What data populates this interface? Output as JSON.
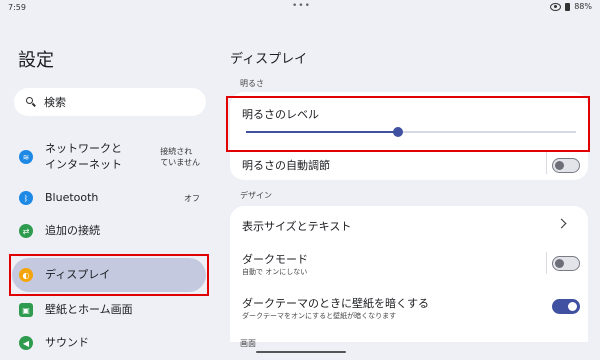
{
  "status_bar": {
    "time": "7:59",
    "battery": "88%"
  },
  "left": {
    "title": "設定",
    "search_label": "検索",
    "items": [
      {
        "label": "ネットワークと\nインターネット",
        "status": "接続され\nていません",
        "icon": "wifi-icon",
        "color": "#1e88e5"
      },
      {
        "label": "Bluetooth",
        "status": "オフ",
        "icon": "bluetooth-icon",
        "color": "#1e88e5"
      },
      {
        "label": "追加の接続",
        "status": "",
        "icon": "connected-devices-icon",
        "color": "#2e9b4e"
      },
      {
        "label": "ディスプレイ",
        "status": "",
        "icon": "brightness-icon",
        "color": "#f2a50c"
      },
      {
        "label": "壁紙とホーム画面",
        "status": "",
        "icon": "wallpaper-icon",
        "color": "#2e9b4e"
      },
      {
        "label": "サウンド",
        "status": "",
        "icon": "sound-icon",
        "color": "#2e9b4e"
      }
    ]
  },
  "right": {
    "title": "ディスプレイ",
    "brightness_section": "明るさ",
    "brightness_level_label": "明るさのレベル",
    "brightness_level": 0.46,
    "auto_brightness_label": "明るさの自動調節",
    "auto_brightness_on": false,
    "design_section": "デザイン",
    "display_size_label": "表示サイズとテキスト",
    "dark_mode_label": "ダークモード",
    "dark_mode_sub": "自動で オンにしない",
    "dark_mode_on": false,
    "dark_wallpaper_label": "ダークテーマのときに壁紙を暗くする",
    "dark_wallpaper_sub": "ダークテーマをオンにすると壁紙が暗くなります",
    "dark_wallpaper_on": true,
    "screen_section": "画面"
  },
  "colors": {
    "accent": "#3f51a0",
    "highlight": "#c4c9e0",
    "annotation": "#e00000"
  }
}
